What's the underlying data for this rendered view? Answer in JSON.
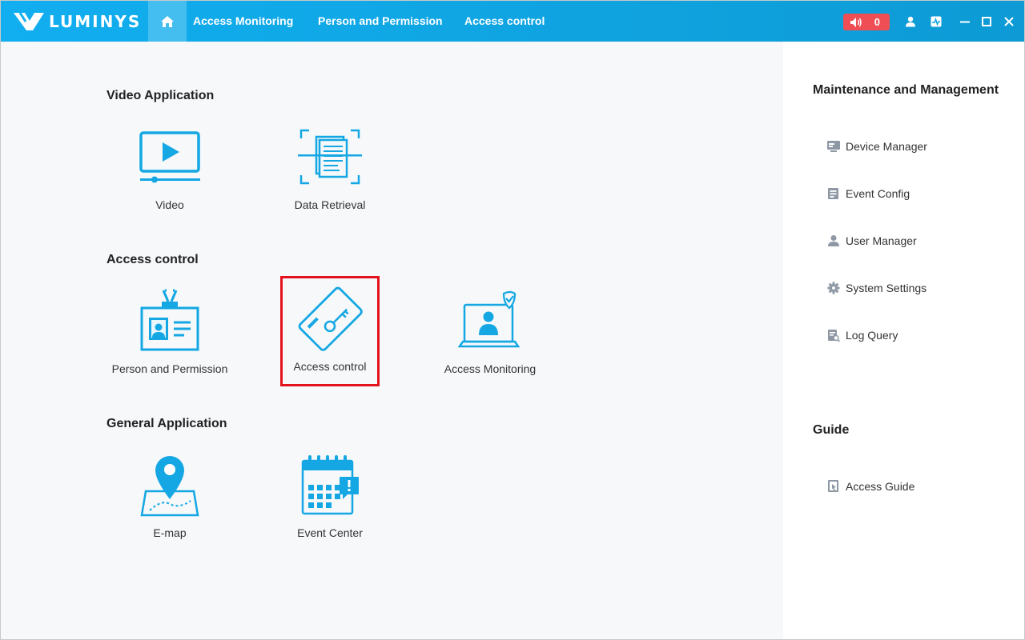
{
  "brand": {
    "name": "LUMINYS"
  },
  "topbar": {
    "tabs": [
      {
        "label": "Access Monitoring"
      },
      {
        "label": "Person and Permission"
      },
      {
        "label": "Access control"
      }
    ],
    "alarm_count": "0"
  },
  "main": {
    "sections": [
      {
        "title": "Video Application",
        "apps": [
          {
            "label": "Video"
          },
          {
            "label": "Data Retrieval"
          }
        ]
      },
      {
        "title": "Access control",
        "apps": [
          {
            "label": "Person and Permission"
          },
          {
            "label": "Access control"
          },
          {
            "label": "Access Monitoring"
          }
        ]
      },
      {
        "title": "General Application",
        "apps": [
          {
            "label": "E-map"
          },
          {
            "label": "Event Center"
          }
        ]
      }
    ]
  },
  "side": {
    "maintenance_title": "Maintenance and Management",
    "maintenance_items": [
      {
        "label": "Device Manager"
      },
      {
        "label": "Event Config"
      },
      {
        "label": "User Manager"
      },
      {
        "label": "System Settings"
      },
      {
        "label": "Log Query"
      }
    ],
    "guide_title": "Guide",
    "guide_items": [
      {
        "label": "Access Guide"
      }
    ]
  },
  "colors": {
    "accent": "#11aef0",
    "icon": "#14a7e3",
    "alarm": "#ef4f54",
    "highlight": "#e4121c"
  }
}
